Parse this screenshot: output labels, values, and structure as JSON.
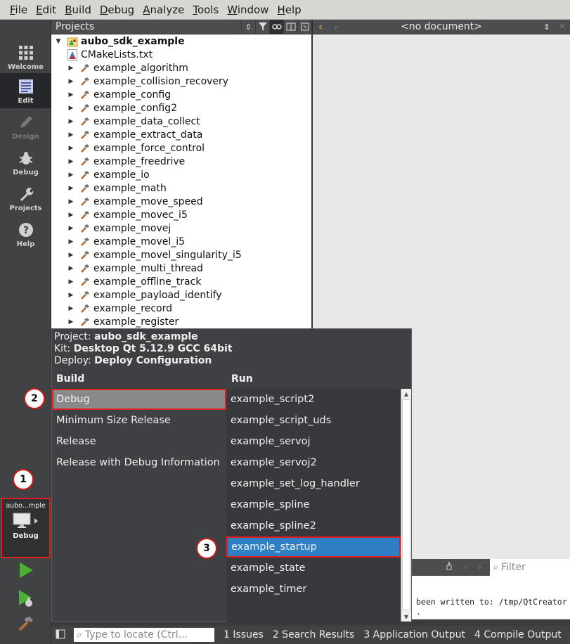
{
  "menu": [
    "File",
    "Edit",
    "Build",
    "Debug",
    "Analyze",
    "Tools",
    "Window",
    "Help"
  ],
  "modes": {
    "welcome": "Welcome",
    "edit": "Edit",
    "design": "Design",
    "debug": "Debug",
    "projects": "Projects",
    "help": "Help"
  },
  "kit_selector": {
    "project_short": "aubo...mple",
    "build_config": "Debug"
  },
  "badges": {
    "one": "1",
    "two": "2",
    "three": "3"
  },
  "projects_pane": {
    "title": "Projects",
    "root": "aubo_sdk_example",
    "file": "CMakeLists.txt",
    "items": [
      "example_algorithm",
      "example_collision_recovery",
      "example_config",
      "example_config2",
      "example_data_collect",
      "example_extract_data",
      "example_force_control",
      "example_freedrive",
      "example_io",
      "example_math",
      "example_move_speed",
      "example_movec_i5",
      "example_movej",
      "example_movel_i5",
      "example_movel_singularity_i5",
      "example_multi_thread",
      "example_offline_track",
      "example_payload_identify",
      "example_record",
      "example_register"
    ]
  },
  "editor": {
    "document": "<no document>"
  },
  "output": {
    "filter_placeholder": "Filter",
    "line": "been written to: /tmp/QtCreator",
    "tail": "."
  },
  "popup": {
    "project_label": "Project:",
    "project": "aubo_sdk_example",
    "kit_label": "Kit:",
    "kit": "Desktop Qt 5.12.9 GCC 64bit",
    "deploy_label": "Deploy:",
    "deploy": "Deploy Configuration",
    "build_heading": "Build",
    "run_heading": "Run",
    "build_items": [
      "Debug",
      "Minimum Size Release",
      "Release",
      "Release with Debug Information"
    ],
    "run_items": [
      "example_script2",
      "example_script_uds",
      "example_servoj",
      "example_servoj2",
      "example_set_log_handler",
      "example_spline",
      "example_spline2",
      "example_startup",
      "example_state",
      "example_timer"
    ]
  },
  "statusbar": {
    "locate_placeholder": "Type to locate (Ctrl...",
    "tabs": [
      "1  Issues",
      "2  Search Results",
      "3  Application Output",
      "4  Compile Output"
    ]
  },
  "colors": {
    "selection_blue": "#2f7fc4",
    "highlight_red": "#e02020"
  }
}
